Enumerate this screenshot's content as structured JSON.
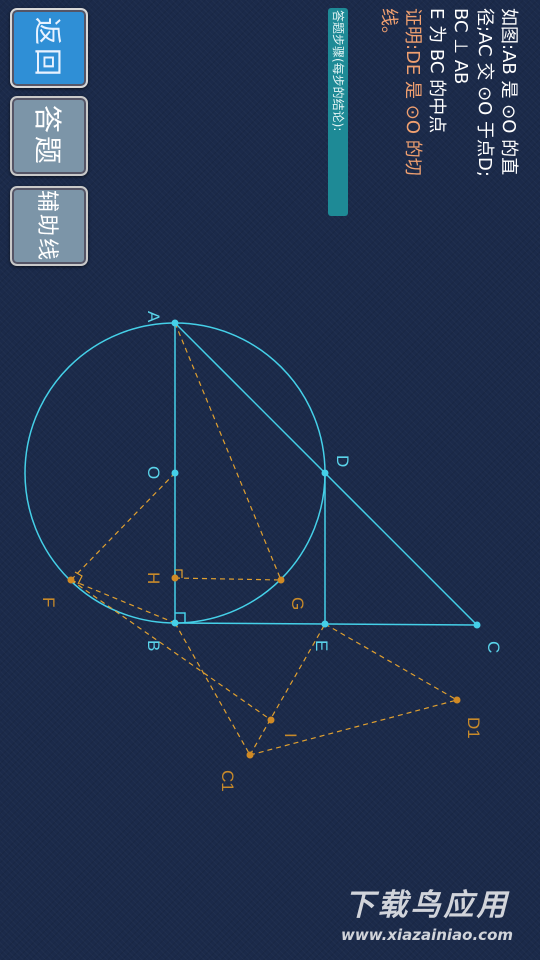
{
  "buttons": {
    "back": "返回",
    "answer": "答题",
    "aux_line": "辅助线"
  },
  "problem": {
    "lines": [
      "如图:AB 是 ⊙O 的直",
      "径;AC 交 ⊙O 于点D;",
      "BC ⊥ AB",
      "E 为 BC 的中点"
    ],
    "prove_lines": [
      "证明:DE 是 ⊙O 的切",
      "线。"
    ]
  },
  "answer_steps_label": "答题步骤(每步的结论):",
  "figure": {
    "points": {
      "A": "A",
      "O": "O",
      "D": "D",
      "H": "H",
      "B": "B",
      "F": "F",
      "G": "G",
      "E": "E",
      "C": "C",
      "I": "I",
      "C1": "C1",
      "D1": "D1"
    }
  },
  "colors": {
    "solid": "#45d0e8",
    "aux": "#e0a030",
    "label_main": "#5ad4ea",
    "label_aux": "#c88a2a"
  },
  "watermark": {
    "main": "下载鸟应用",
    "url": "www.xiazainiao.com"
  }
}
